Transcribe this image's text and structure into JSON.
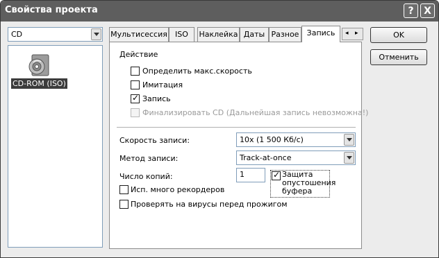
{
  "window": {
    "title": "Свойства проекта",
    "help": "?",
    "close": "X"
  },
  "project_type": {
    "selected": "CD"
  },
  "media_list": [
    {
      "label": "CD-ROM (ISO)"
    }
  ],
  "tabs": [
    {
      "label": "Мультисессия"
    },
    {
      "label": "ISO"
    },
    {
      "label": "Наклейка"
    },
    {
      "label": "Даты"
    },
    {
      "label": "Разное"
    },
    {
      "label": "Запись",
      "active": true
    }
  ],
  "tab_nav": {
    "left": "◂",
    "right": "▸"
  },
  "action": {
    "heading": "Действие",
    "max_speed": {
      "label": "Определить макс.скорость",
      "checked": false
    },
    "simulation": {
      "label": "Имитация",
      "checked": false
    },
    "write": {
      "label": "Запись",
      "checked": true
    },
    "finalize": {
      "label": "Финализировать CD (Дальнейшая запись невозможна!)",
      "checked": false,
      "disabled": true
    }
  },
  "settings": {
    "speed_label": "Скорость записи:",
    "speed_value": "10x (1 500 Кб/с)",
    "method_label": "Метод записи:",
    "method_value": "Track-at-once",
    "copies_label": "Число копий:",
    "copies_value": "1",
    "buffer_protect_label": "Защита опустошения буфера",
    "buffer_protect_checked": true,
    "multi_recorders_label": "Исп. много рекордеров",
    "virus_check_label": "Проверять на вирусы перед прожигом"
  },
  "buttons": {
    "ok": "OK",
    "cancel": "Отменить"
  },
  "colors": {
    "titlebar": "#5e5e5e",
    "selection": "#3c3c3c",
    "border": "#7f9db9"
  }
}
